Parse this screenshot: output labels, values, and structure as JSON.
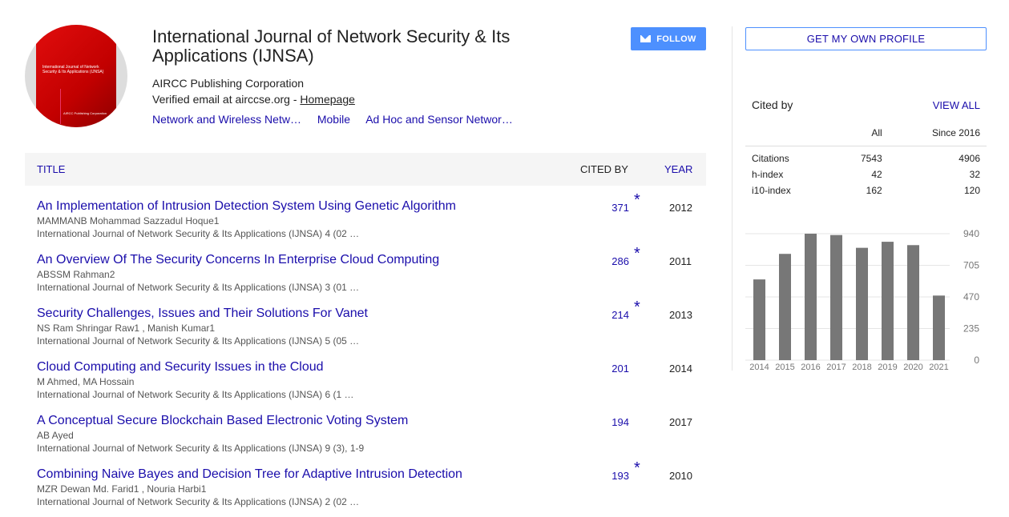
{
  "profile": {
    "name": "International Journal of Network Security & Its Applications (IJNSA)",
    "affiliation": "AIRCC Publishing Corporation",
    "email_text": "Verified email at airccse.org - ",
    "homepage_label": "Homepage",
    "interests": [
      "Network and Wireless Netw…",
      "Mobile",
      "Ad Hoc and Sensor Networ…"
    ],
    "follow_label": "FOLLOW",
    "avatar_cover_title": "International Journal of Network Security & Its Applications (IJNSA)",
    "avatar_cover_publisher": "AIRCC Publishing Corporation"
  },
  "table": {
    "col_title": "TITLE",
    "col_cited": "CITED BY",
    "col_year": "YEAR",
    "rows": [
      {
        "title": "An Implementation of Intrusion Detection System Using Genetic Algorithm",
        "authors": "MAMMANB Mohammad Sazzadul Hoque1",
        "venue": "International Journal of Network Security & Its Applications (IJNSA) 4 (02 …",
        "cited": "371",
        "star": "*",
        "year": "2012"
      },
      {
        "title": "An Overview Of The Security Concerns In Enterprise Cloud Computing",
        "authors": "ABSSM Rahman2",
        "venue": "International Journal of Network Security & Its Applications (IJNSA) 3 (01 …",
        "cited": "286",
        "star": "*",
        "year": "2011"
      },
      {
        "title": "Security Challenges, Issues and Their Solutions For Vanet",
        "authors": "NS Ram Shringar Raw1 , Manish Kumar1",
        "venue": "International Journal of Network Security & Its Applications (IJNSA) 5 (05 …",
        "cited": "214",
        "star": "*",
        "year": "2013"
      },
      {
        "title": "Cloud Computing and Security Issues in the Cloud",
        "authors": "M Ahmed, MA Hossain",
        "venue": "International Journal of Network Security & Its Applications (IJNSA) 6 (1 …",
        "cited": "201",
        "star": "",
        "year": "2014"
      },
      {
        "title": "A Conceptual Secure Blockchain Based Electronic Voting System",
        "authors": "AB Ayed",
        "venue": "International Journal of Network Security & Its Applications (IJNSA) 9 (3), 1-9",
        "cited": "194",
        "star": "",
        "year": "2017"
      },
      {
        "title": "Combining Naive Bayes and Decision Tree for Adaptive Intrusion Detection",
        "authors": "MZR Dewan Md. Farid1 , Nouria Harbi1",
        "venue": "International Journal of Network Security & Its Applications (IJNSA) 2 (02 …",
        "cited": "193",
        "star": "*",
        "year": "2010"
      }
    ]
  },
  "sidebar": {
    "get_profile_label": "GET MY OWN PROFILE",
    "cited_by_title": "Cited by",
    "view_all_label": "VIEW ALL",
    "col_all": "All",
    "col_since": "Since 2016",
    "metrics": [
      {
        "label": "Citations",
        "all": "7543",
        "since": "4906"
      },
      {
        "label": "h-index",
        "all": "42",
        "since": "32"
      },
      {
        "label": "i10-index",
        "all": "162",
        "since": "120"
      }
    ]
  },
  "chart_data": {
    "type": "bar",
    "categories": [
      "2014",
      "2015",
      "2016",
      "2017",
      "2018",
      "2019",
      "2020",
      "2021"
    ],
    "values": [
      600,
      790,
      940,
      930,
      835,
      880,
      855,
      480
    ],
    "yticks": [
      0,
      235,
      470,
      705,
      940
    ],
    "ylim": [
      0,
      940
    ],
    "bar_color": "#777777",
    "title": "",
    "xlabel": "",
    "ylabel": ""
  }
}
